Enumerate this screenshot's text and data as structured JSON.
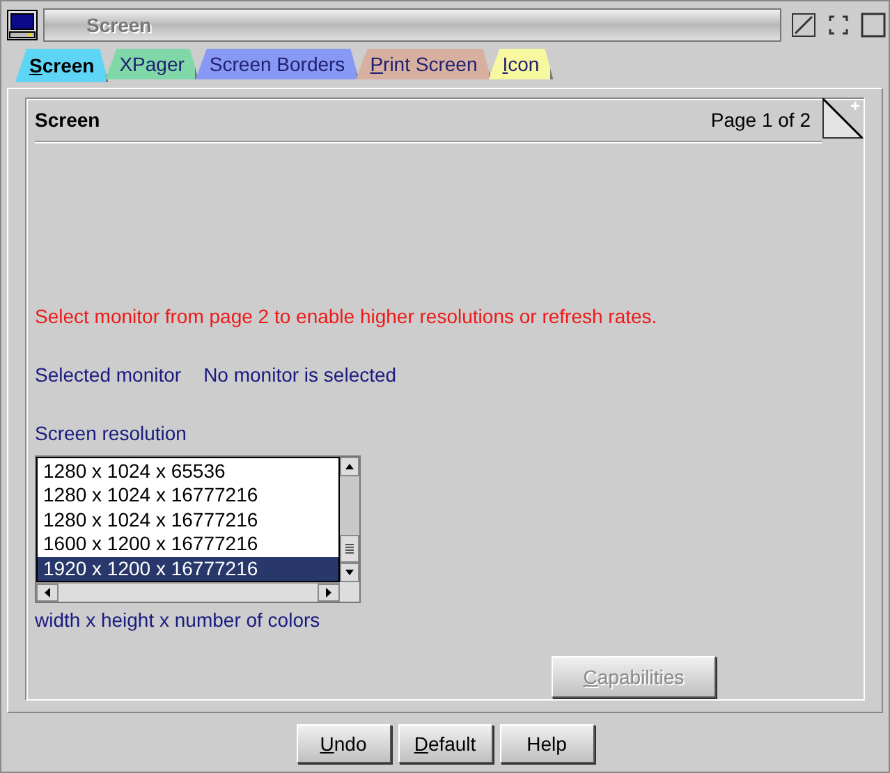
{
  "window": {
    "title": "Screen"
  },
  "tabs": [
    {
      "label": "Screen",
      "selected": true,
      "mnemonic": true,
      "color": "#5fd5f5"
    },
    {
      "label": "XPager",
      "selected": false,
      "mnemonic": false,
      "color": "#80d8a8"
    },
    {
      "label": "Screen Borders",
      "selected": false,
      "mnemonic": false,
      "color": "#8898f5"
    },
    {
      "label": "Print Screen",
      "selected": false,
      "mnemonic": true,
      "color": "#d8b0a0"
    },
    {
      "label": "Icon",
      "selected": false,
      "mnemonic": true,
      "color": "#f8f8a0"
    }
  ],
  "page": {
    "title": "Screen",
    "page_indicator": "Page 1 of 2"
  },
  "warning": "Select monitor from page 2 to enable higher resolutions or refresh rates.",
  "monitor": {
    "label": "Selected monitor",
    "value": "No monitor is selected"
  },
  "resolution": {
    "label": "Screen resolution",
    "hint": "width x height x number of colors",
    "items": [
      {
        "text": "1280 x 1024 x 65536",
        "selected": false
      },
      {
        "text": "1280 x 1024 x 16777216",
        "selected": false
      },
      {
        "text": "1280 x 1024 x 16777216",
        "selected": false
      },
      {
        "text": "1600 x 1200 x 16777216",
        "selected": false
      },
      {
        "text": "1920 x 1200 x 16777216",
        "selected": true
      }
    ]
  },
  "capabilities_button": {
    "label": "Capabilities",
    "disabled": true,
    "mnemonic": true
  },
  "buttons": [
    {
      "label": "Undo",
      "mnemonic": true
    },
    {
      "label": "Default",
      "mnemonic": true
    },
    {
      "label": "Help",
      "mnemonic": false
    }
  ]
}
